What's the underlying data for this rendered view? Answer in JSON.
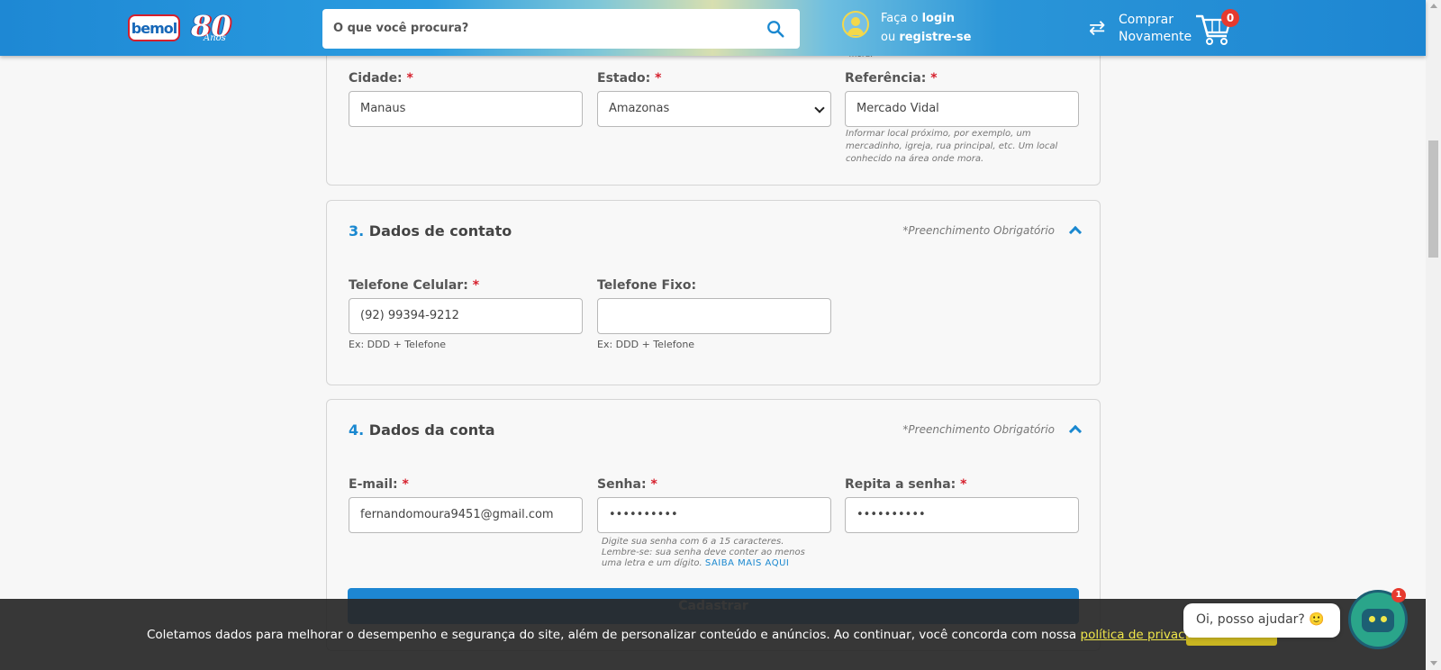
{
  "header": {
    "logo_text": "bemol",
    "anos_number": "80",
    "anos_text": "Anos",
    "search_placeholder": "O que você procura?",
    "login_line1_prefix": "Faça o ",
    "login_line1_bold": "login",
    "login_line2_prefix": "ou ",
    "login_line2_bold": "registre-se",
    "buyagain_line1": "Comprar",
    "buyagain_line2": "Novamente",
    "cart_count": "0"
  },
  "address": {
    "partial_top_text": "mora.",
    "cidade_label": "Cidade:",
    "cidade_value": "Manaus",
    "estado_label": "Estado:",
    "estado_value": "Amazonas",
    "referencia_label": "Referência:",
    "referencia_value": "Mercado Vidal",
    "referencia_help": "Informar local próximo, por exemplo, um mercadinho, igreja, rua principal, etc. Um local conhecido na área onde mora.",
    "required_mark": "*"
  },
  "contact": {
    "number": "3.",
    "title": "Dados de contato",
    "required_note": "*Preenchimento Obrigatório",
    "celular_label": "Telefone Celular:",
    "celular_value": "(92) 99394-9212",
    "celular_help": "Ex: DDD + Telefone",
    "fixo_label": "Telefone Fixo:",
    "fixo_value": "",
    "fixo_help": "Ex: DDD + Telefone"
  },
  "account": {
    "number": "4.",
    "title": "Dados da conta",
    "required_note": "*Preenchimento Obrigatório",
    "email_label": "E-mail:",
    "email_value": "fernandomoura9451@gmail.com",
    "senha_label": "Senha:",
    "senha_value": "••••••••••",
    "senha_help_1": "Digite sua senha com 6 a 15 caracteres.",
    "senha_help_2": "Lembre-se: sua senha deve conter ao menos",
    "senha_help_3": "uma letra e um dígito.",
    "senha_help_link": "SAIBA MAIS AQUI",
    "repita_label": "Repita a senha:",
    "repita_value": "••••••••••",
    "submit_label": "Cadastrar"
  },
  "cookie": {
    "text": "Coletamos dados para melhorar o desempenho e segurança do site, além de personalizar conteúdo e anúncios. Ao continuar, você concorda com nossa ",
    "link": "política de privacidade.",
    "suffix": ".",
    "button": "Aceitar e Fechar"
  },
  "chat": {
    "bubble": "Oi, posso ajudar? 🙂",
    "badge": "1"
  }
}
